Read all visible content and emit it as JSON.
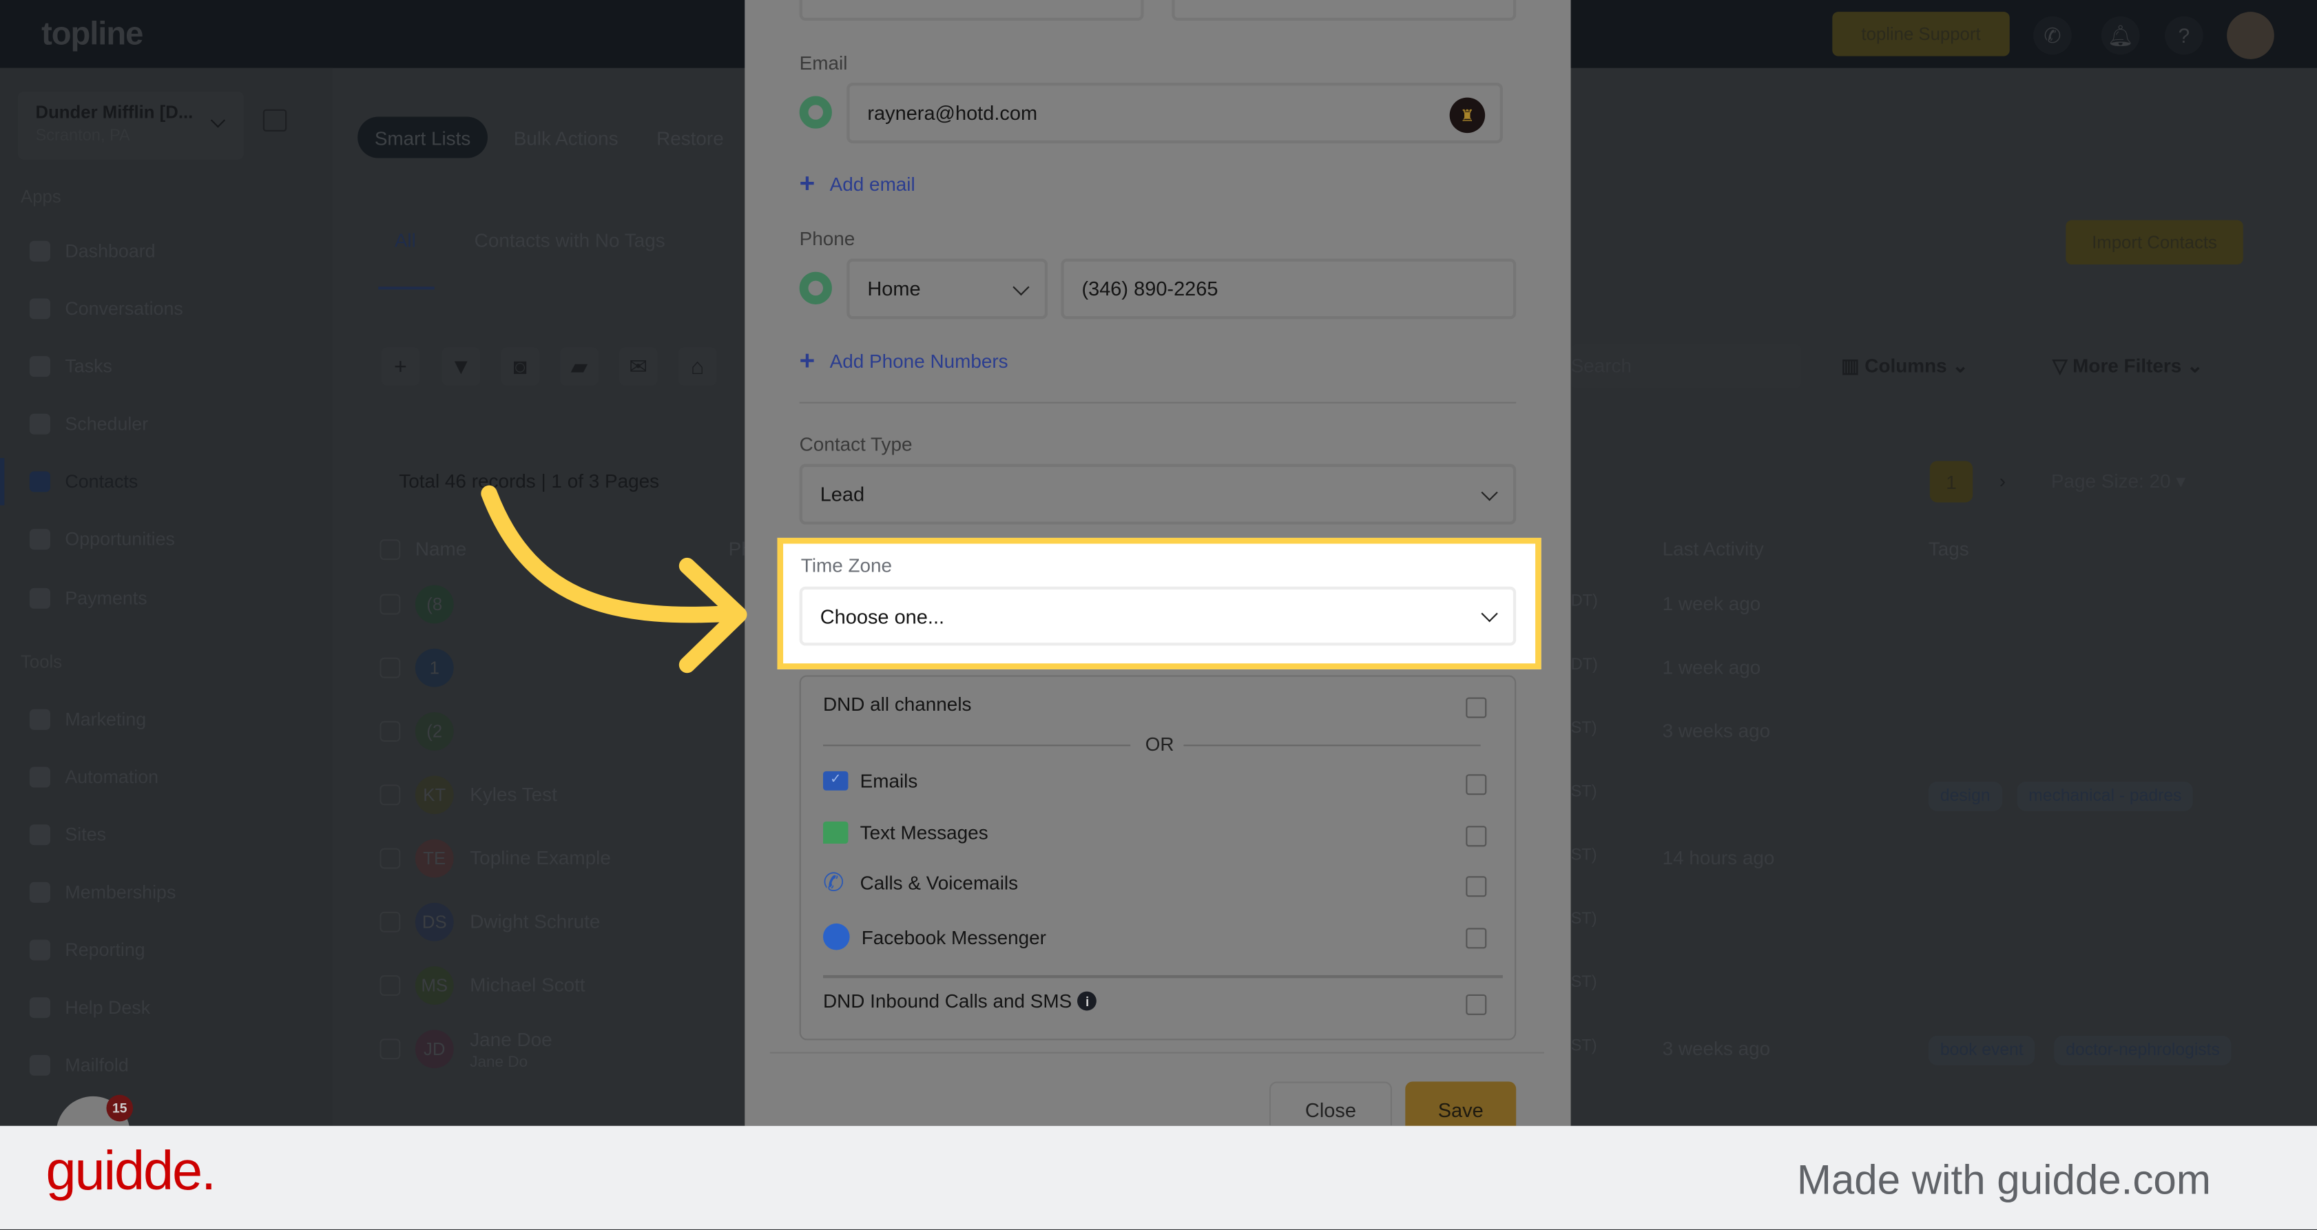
{
  "topbar": {
    "logo": "topline",
    "support": "topline Support",
    "icons": [
      "phone-icon",
      "bell-icon",
      "help-icon",
      "user-avatar"
    ]
  },
  "sidebar": {
    "account_name": "Dunder Mifflin [D...",
    "account_location": "Scranton, PA",
    "apps_heading": "Apps",
    "apps": [
      {
        "label": "Dashboard"
      },
      {
        "label": "Conversations"
      },
      {
        "label": "Tasks"
      },
      {
        "label": "Scheduler"
      },
      {
        "label": "Contacts",
        "active": true
      },
      {
        "label": "Opportunities"
      },
      {
        "label": "Payments"
      }
    ],
    "tools_heading": "Tools",
    "tools": [
      {
        "label": "Marketing"
      },
      {
        "label": "Automation"
      },
      {
        "label": "Sites"
      },
      {
        "label": "Memberships"
      },
      {
        "label": "Reporting"
      },
      {
        "label": "Help Desk"
      },
      {
        "label": "Mailfold"
      }
    ],
    "notification_count": "15"
  },
  "main": {
    "tabs": [
      "Smart Lists",
      "Bulk Actions",
      "Restore"
    ],
    "subtabs": [
      "All",
      "Contacts with No Tags"
    ],
    "import_button": "Import Contacts",
    "search_placeholder": "Search",
    "columns_button": "Columns",
    "more_filters_button": "More Filters",
    "records_summary": "Total 46 records | 1 of 3 Pages",
    "current_page": "1",
    "page_size": "Page Size: 20",
    "table": {
      "headers": {
        "name": "Name",
        "phone": "Ph",
        "last_activity": "Last Activity",
        "tags": "Tags"
      },
      "rows": [
        {
          "initials": "(8",
          "name": "",
          "tz": "DT)",
          "last_activity": "1 week ago",
          "tags": []
        },
        {
          "initials": "1",
          "name": "",
          "tz": "DT)",
          "last_activity": "1 week ago",
          "tags": []
        },
        {
          "initials": "(2",
          "name": "",
          "tz": "ST)",
          "last_activity": "3 weeks ago",
          "tags": []
        },
        {
          "initials": "KT",
          "name": "Kyles Test",
          "tz": "ST)",
          "last_activity": "",
          "tags": [
            "design",
            "mechanical - padres"
          ]
        },
        {
          "initials": "TE",
          "name": "Topline Example",
          "tz": "ST)",
          "last_activity": "14 hours ago",
          "tags": []
        },
        {
          "initials": "DS",
          "name": "Dwight Schrute",
          "tz": "ST)",
          "last_activity": "",
          "tags": []
        },
        {
          "initials": "MS",
          "name": "Michael Scott",
          "tz": "ST)",
          "last_activity": "",
          "tags": []
        },
        {
          "initials": "JD",
          "name": "Jane Doe",
          "sub": "Jane Do",
          "tz": "ST)",
          "last_activity": "3 weeks ago",
          "tags": [
            "book event",
            "doctor-nephrologists"
          ]
        }
      ]
    }
  },
  "modal": {
    "email_label": "Email",
    "email_value": "raynera@hotd.com",
    "add_email": "Add email",
    "phone_label": "Phone",
    "phone_type": "Home",
    "phone_value": "(346) 890-2265",
    "add_phone": "Add Phone Numbers",
    "contact_type_label": "Contact Type",
    "contact_type_value": "Lead",
    "timezone_label": "Time Zone",
    "timezone_placeholder": "Choose one...",
    "dnd_all": "DND all channels",
    "or": "OR",
    "channels": [
      {
        "label": "Emails",
        "icon": "email-icon",
        "checked": false
      },
      {
        "label": "Text Messages",
        "icon": "sms-icon",
        "checked": false
      },
      {
        "label": "Calls & Voicemails",
        "icon": "phone-icon",
        "checked": false
      },
      {
        "label": "Facebook Messenger",
        "icon": "messenger-icon",
        "checked": false
      }
    ],
    "dnd_inbound": "DND Inbound Calls and SMS",
    "close": "Close",
    "save": "Save"
  },
  "highlight_color": "#fdd14a",
  "footer": {
    "brand": "guidde.",
    "credit": "Made with guidde.com"
  }
}
